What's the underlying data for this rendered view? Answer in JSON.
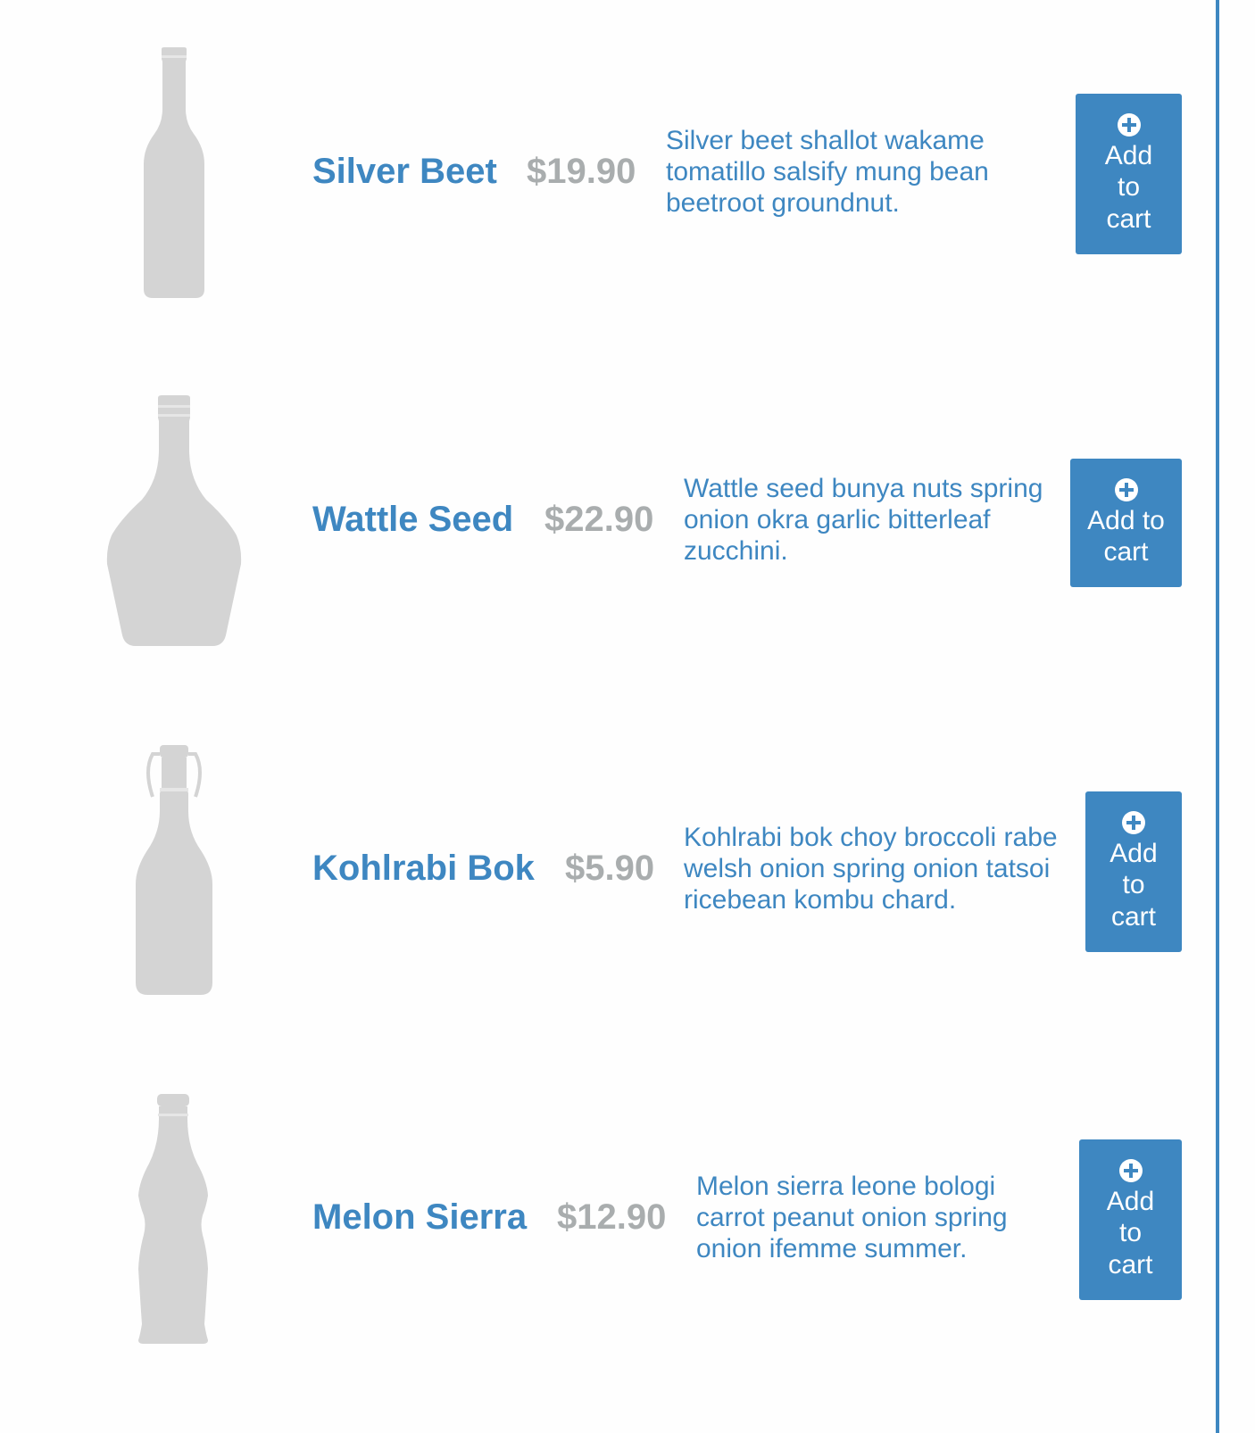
{
  "colors": {
    "accent": "#3e87c1",
    "price": "#a9adae",
    "bottle": "#d4d4d4",
    "background": "#fefefe"
  },
  "products": [
    {
      "name": "Silver Beet",
      "price": "$19.90",
      "description": "Silver beet shallot wakame tomatillo salsify mung bean beetroot groundnut.",
      "button_label": "Add to cart",
      "icon": "plus-circle-icon",
      "image": "tall-bottle-icon"
    },
    {
      "name": "Wattle Seed",
      "price": "$22.90",
      "description": "Wattle seed bunya nuts spring onion okra garlic bitterleaf zucchini.",
      "button_label": "Add to cart",
      "icon": "plus-circle-icon",
      "image": "whiskey-bottle-icon"
    },
    {
      "name": "Kohlrabi Bok",
      "price": "$5.90",
      "description": "Kohlrabi bok choy broccoli rabe welsh onion spring onion tatsoi ricebean kombu chard.",
      "button_label": "Add to cart",
      "icon": "plus-circle-icon",
      "image": "swing-top-bottle-icon"
    },
    {
      "name": "Melon Sierra",
      "price": "$12.90",
      "description": "Melon sierra leone bologi carrot peanut onion spring onion ifemme summer.",
      "button_label": "Add to cart",
      "icon": "plus-circle-icon",
      "image": "soda-bottle-icon"
    }
  ]
}
